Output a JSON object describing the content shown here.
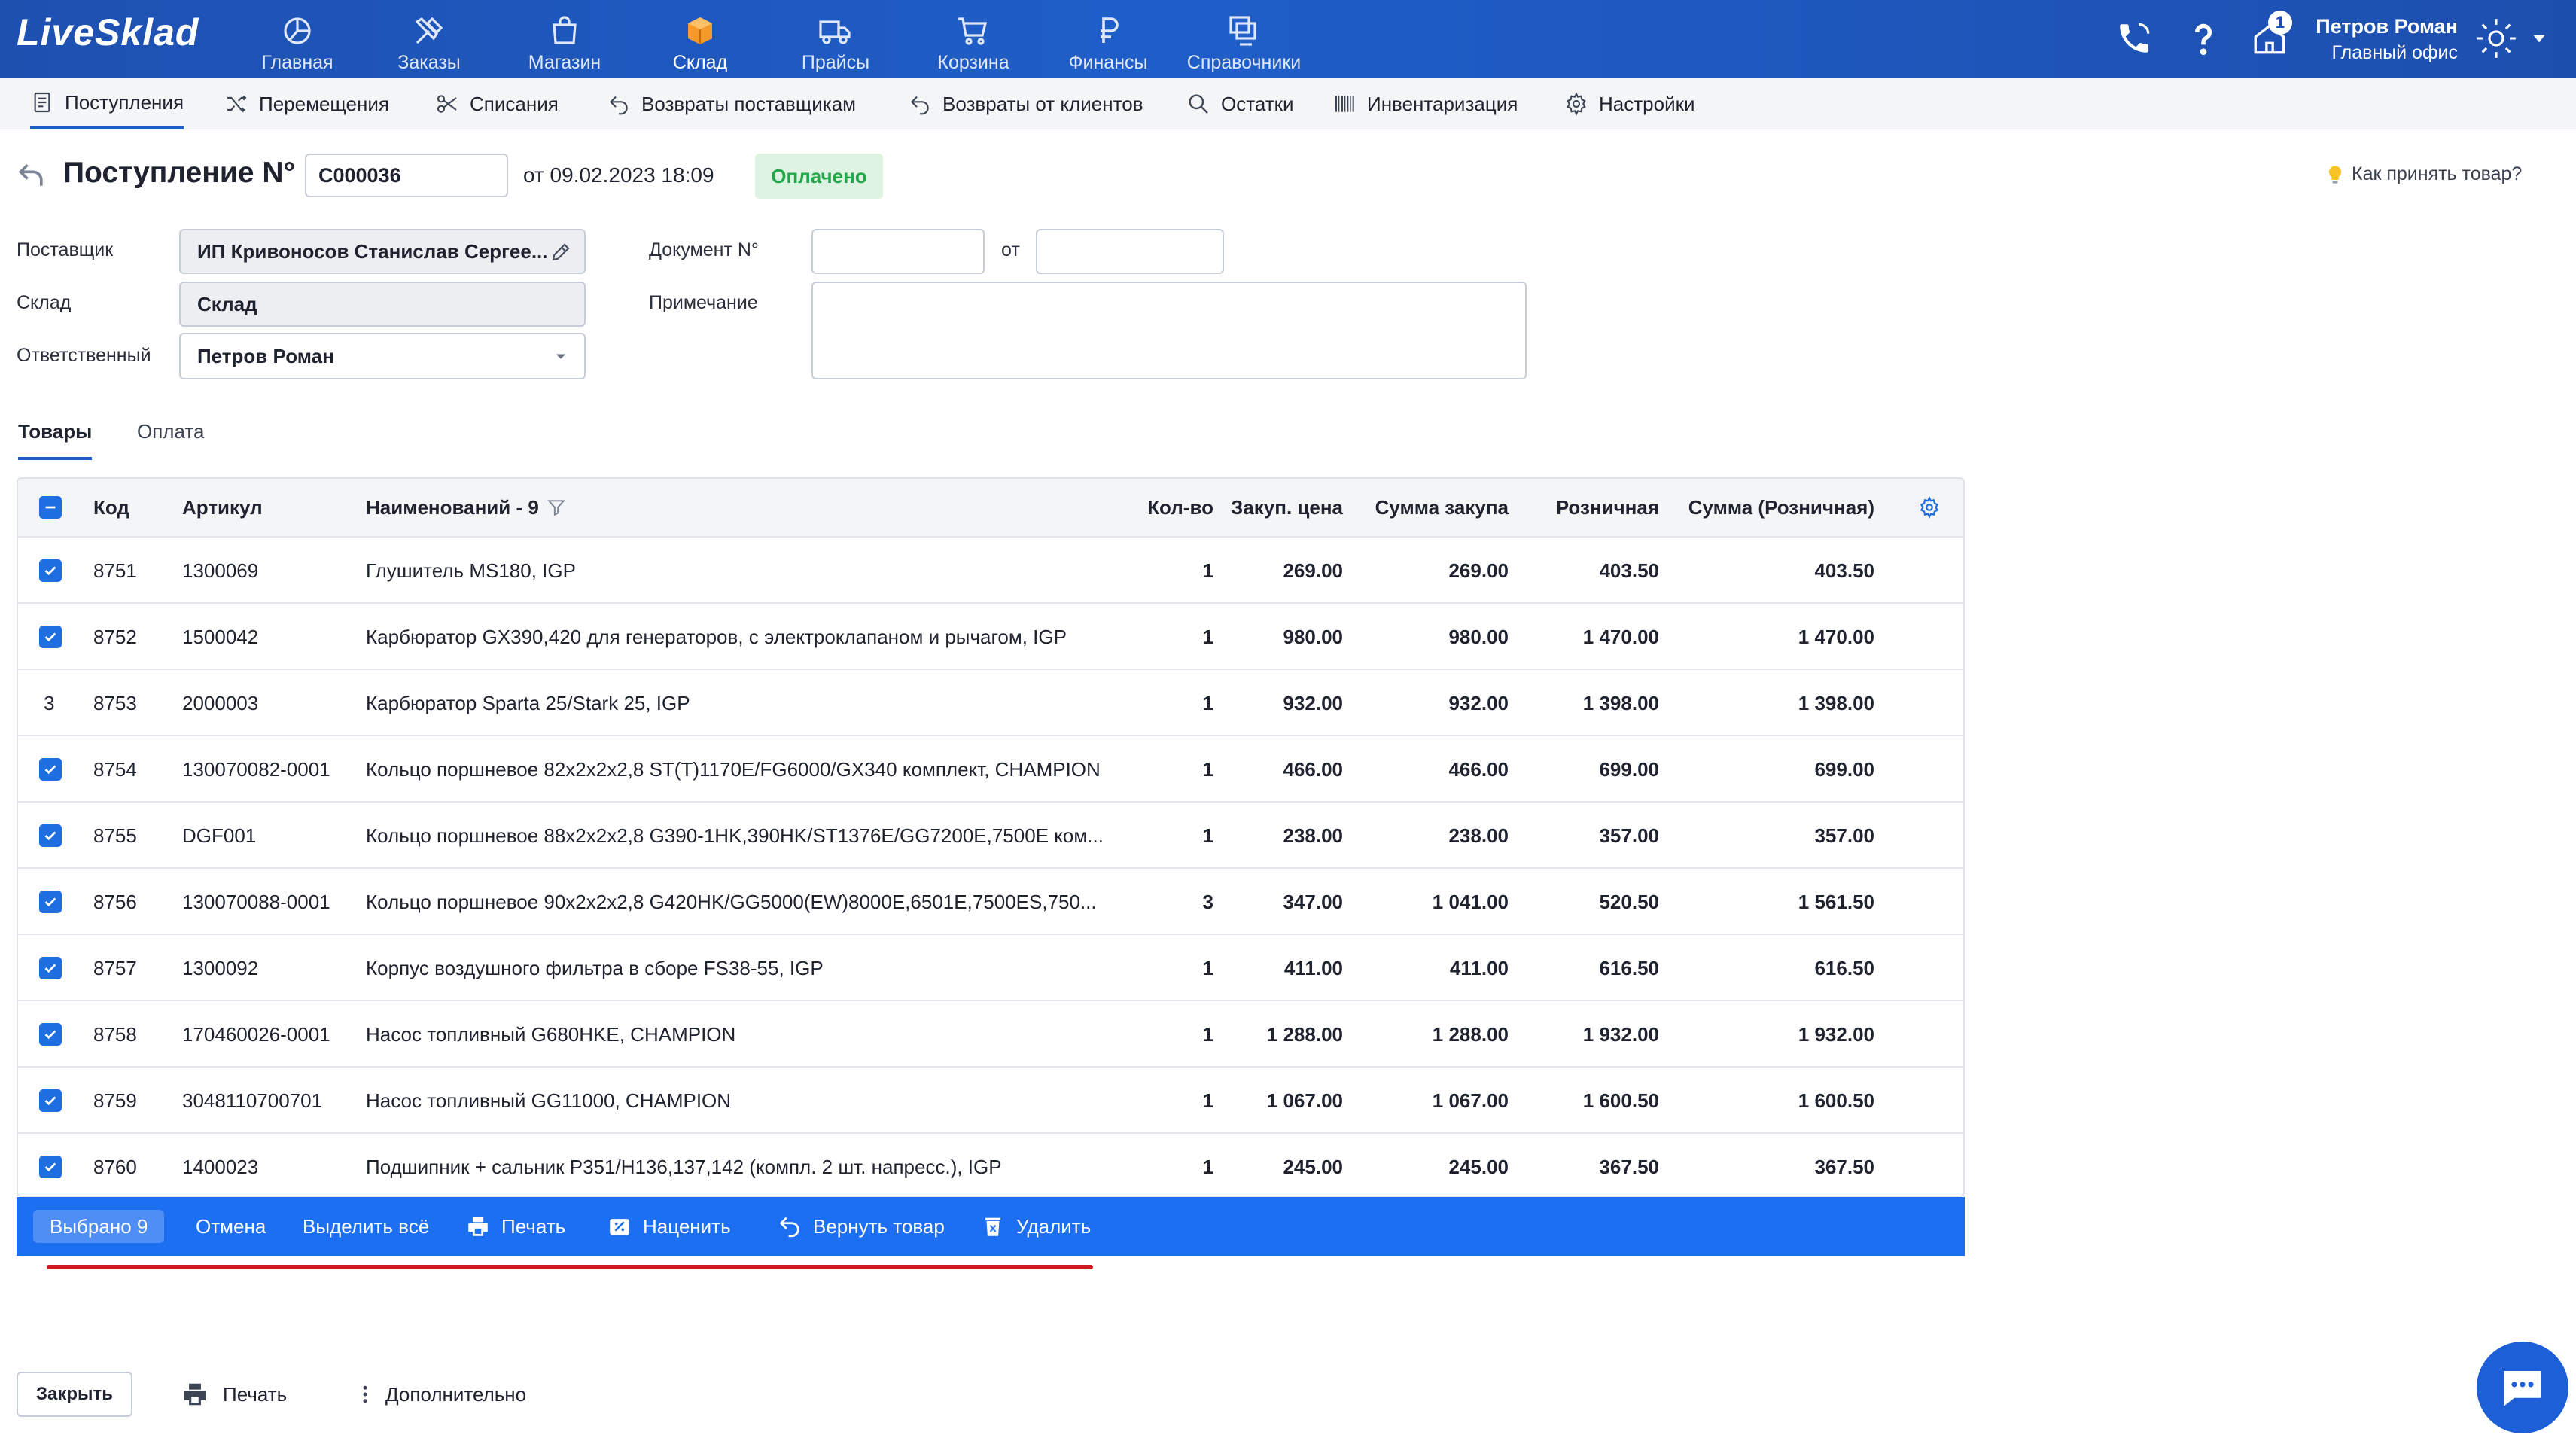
{
  "app": {
    "logo": "LiveSklad"
  },
  "nav": [
    {
      "label": "Главная",
      "icon": "pie-chart-icon"
    },
    {
      "label": "Заказы",
      "icon": "tools-icon"
    },
    {
      "label": "Магазин",
      "icon": "shopping-bag-icon"
    },
    {
      "label": "Склад",
      "icon": "box-icon"
    },
    {
      "label": "Прайсы",
      "icon": "truck-icon"
    },
    {
      "label": "Корзина",
      "icon": "cart-icon"
    },
    {
      "label": "Финансы",
      "icon": "ruble-icon"
    },
    {
      "label": "Справочники",
      "icon": "windows-icon"
    }
  ],
  "topbar": {
    "notification_count": "1",
    "user_name": "Петров Роман",
    "user_office": "Главный офис"
  },
  "subnav": [
    {
      "label": "Поступления",
      "icon": "receipt-icon"
    },
    {
      "label": "Перемещения",
      "icon": "shuffle-icon"
    },
    {
      "label": "Списания",
      "icon": "scissors-icon"
    },
    {
      "label": "Возвраты поставщикам",
      "icon": "return-icon"
    },
    {
      "label": "Возвраты от клиентов",
      "icon": "return-icon"
    },
    {
      "label": "Остатки",
      "icon": "search-icon"
    },
    {
      "label": "Инвентаризация",
      "icon": "barcode-icon"
    },
    {
      "label": "Настройки",
      "icon": "gear-icon"
    }
  ],
  "header": {
    "title": "Поступление N°",
    "doc_number": "С000036",
    "date": "от 09.02.2023 18:09",
    "status": "Оплачено",
    "help": "Как принять товар?"
  },
  "form": {
    "supplier_label": "Поставщик",
    "supplier_value": "ИП Кривоносов Станислав Сергее...",
    "warehouse_label": "Склад",
    "warehouse_value": "Склад",
    "responsible_label": "Ответственный",
    "responsible_value": "Петров Роман",
    "doc_label": "Документ N°",
    "from_label": "от",
    "note_label": "Примечание"
  },
  "tabs": {
    "products": "Товары",
    "payment": "Оплата"
  },
  "table": {
    "columns": {
      "code": "Код",
      "article": "Артикул",
      "name": "Наименований - 9",
      "qty": "Кол-во",
      "price": "Закуп. цена",
      "sum": "Сумма закупа",
      "retail": "Розничная",
      "retail_sum": "Сумма (Розничная)"
    },
    "rows": [
      {
        "sel": "check",
        "code": "8751",
        "article": "1300069",
        "name": "Глушитель MS180, IGP",
        "qty": "1",
        "price": "269.00",
        "sum": "269.00",
        "retail": "403.50",
        "retail_sum": "403.50"
      },
      {
        "sel": "check",
        "code": "8752",
        "article": "1500042",
        "name": "Карбюратор GX390,420 для генераторов, с электроклапаном и рычагом, IGP",
        "qty": "1",
        "price": "980.00",
        "sum": "980.00",
        "retail": "1 470.00",
        "retail_sum": "1 470.00"
      },
      {
        "sel": "3",
        "code": "8753",
        "article": "2000003",
        "name": "Карбюратор Sparta 25/Stark 25, IGP",
        "qty": "1",
        "price": "932.00",
        "sum": "932.00",
        "retail": "1 398.00",
        "retail_sum": "1 398.00"
      },
      {
        "sel": "check",
        "code": "8754",
        "article": "130070082-0001",
        "name": "Кольцо поршневое 82x2x2x2,8 ST(T)1170E/FG6000/GX340 комплект, CHAMPION",
        "qty": "1",
        "price": "466.00",
        "sum": "466.00",
        "retail": "699.00",
        "retail_sum": "699.00"
      },
      {
        "sel": "check",
        "code": "8755",
        "article": "DGF001",
        "name": "Кольцо поршневое 88x2x2x2,8 G390-1HK,390HK/ST1376E/GG7200E,7500E ком...",
        "qty": "1",
        "price": "238.00",
        "sum": "238.00",
        "retail": "357.00",
        "retail_sum": "357.00"
      },
      {
        "sel": "check",
        "code": "8756",
        "article": "130070088-0001",
        "name": "Кольцо поршневое 90x2x2x2,8 G420HK/GG5000(EW)8000E,6501E,7500ES,750...",
        "qty": "3",
        "price": "347.00",
        "sum": "1 041.00",
        "retail": "520.50",
        "retail_sum": "1 561.50"
      },
      {
        "sel": "check",
        "code": "8757",
        "article": "1300092",
        "name": "Корпус воздушного фильтра в сборе FS38-55, IGP",
        "qty": "1",
        "price": "411.00",
        "sum": "411.00",
        "retail": "616.50",
        "retail_sum": "616.50"
      },
      {
        "sel": "check",
        "code": "8758",
        "article": "170460026-0001",
        "name": "Насос топливный G680HKE, CHAMPION",
        "qty": "1",
        "price": "1 288.00",
        "sum": "1 288.00",
        "retail": "1 932.00",
        "retail_sum": "1 932.00"
      },
      {
        "sel": "check",
        "code": "8759",
        "article": "3048110700701",
        "name": "Насос топливный GG11000, CHAMPION",
        "qty": "1",
        "price": "1 067.00",
        "sum": "1 067.00",
        "retail": "1 600.50",
        "retail_sum": "1 600.50"
      },
      {
        "sel": "check",
        "code": "8760",
        "article": "1400023",
        "name": "Подшипник + сальник P351/H136,137,142 (компл. 2 шт. напресс.), IGP",
        "qty": "1",
        "price": "245.00",
        "sum": "245.00",
        "retail": "367.50",
        "retail_sum": "367.50"
      }
    ]
  },
  "actions": {
    "selected": "Выбрано 9",
    "cancel": "Отмена",
    "select_all": "Выделить всё",
    "print": "Печать",
    "reprice": "Наценить",
    "return": "Вернуть товар",
    "delete": "Удалить"
  },
  "footer": {
    "close": "Закрыть",
    "print": "Печать",
    "more": "Дополнительно"
  }
}
